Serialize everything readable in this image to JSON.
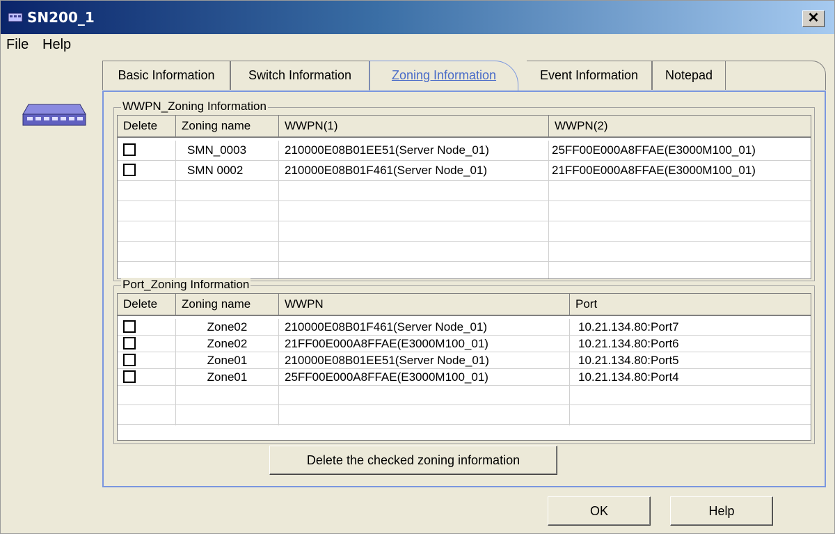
{
  "window": {
    "title": "SN200_1",
    "close_glyph": "✕"
  },
  "menu": [
    "File",
    "Help"
  ],
  "tabs": [
    {
      "label": "Basic Information",
      "active": false
    },
    {
      "label": "Switch Information",
      "active": false
    },
    {
      "label": "Zoning Information",
      "active": true
    },
    {
      "label": "Event Information",
      "active": false
    },
    {
      "label": "Notepad",
      "active": false
    }
  ],
  "wwpn_zoning": {
    "title": "WWPN_Zoning Information",
    "columns": [
      "Delete",
      "Zoning name",
      "WWPN(1)",
      "WWPN(2)"
    ],
    "rows": [
      {
        "checked": false,
        "name": "SMN_0003",
        "wwpn1": "210000E08B01EE51(Server Node_01)",
        "wwpn2": "25FF00E000A8FFAE(E3000M100_01)"
      },
      {
        "checked": false,
        "name": "SMN 0002",
        "wwpn1": "210000E08B01F461(Server Node_01)",
        "wwpn2": "21FF00E000A8FFAE(E3000M100_01)"
      }
    ],
    "empty_rows": 5
  },
  "port_zoning": {
    "title": "Port_Zoning Information",
    "columns": [
      "Delete",
      "Zoning name",
      "WWPN",
      "Port"
    ],
    "rows": [
      {
        "checked": false,
        "name": "Zone02",
        "wwpn": "210000E08B01F461(Server Node_01)",
        "port": "10.21.134.80:Port7"
      },
      {
        "checked": false,
        "name": "Zone02",
        "wwpn": "21FF00E000A8FFAE(E3000M100_01)",
        "port": "10.21.134.80:Port6"
      },
      {
        "checked": false,
        "name": "Zone01",
        "wwpn": "210000E08B01EE51(Server Node_01)",
        "port": "10.21.134.80:Port5"
      },
      {
        "checked": false,
        "name": "Zone01",
        "wwpn": "25FF00E000A8FFAE(E3000M100_01)",
        "port": "10.21.134.80:Port4"
      }
    ],
    "empty_rows": 2
  },
  "buttons": {
    "delete": "Delete the checked zoning information",
    "ok": "OK",
    "help": "Help"
  },
  "icons": {
    "app": "switch-device-icon",
    "side": "switch-device-icon"
  },
  "colors": {
    "title_start": "#0a246a",
    "title_end": "#a6caf0",
    "tab_accent": "#7a96df",
    "active_tab_text": "#4a6cc8"
  }
}
